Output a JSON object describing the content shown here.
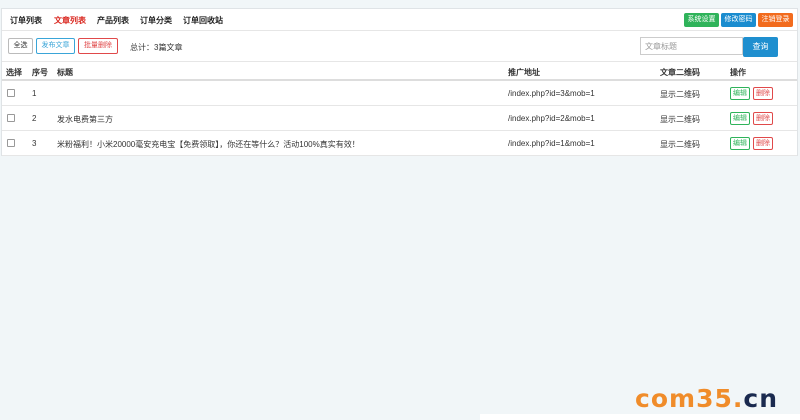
{
  "nav": {
    "items": [
      "订单列表",
      "文章列表",
      "产品列表",
      "订单分类",
      "订单回收站"
    ],
    "active_index": 1,
    "right_buttons": [
      "系统设置",
      "修改密码",
      "注销登录"
    ]
  },
  "toolbar": {
    "select_all": "全选",
    "publish": "发布文章",
    "batch_delete": "批量删除",
    "total": "总计：3篇文章",
    "search_placeholder": "文章标题",
    "search_button": "查询"
  },
  "table": {
    "headers": [
      "选择",
      "序号",
      "标题",
      "推广地址",
      "文章二维码",
      "操作"
    ],
    "rows": [
      {
        "index": "1",
        "title": "",
        "url": "/index.php?id=3&mob=1",
        "qr": "显示二维码"
      },
      {
        "index": "2",
        "title": "发水电费第三方",
        "url": "/index.php?id=2&mob=1",
        "qr": "显示二维码"
      },
      {
        "index": "3",
        "title": "米粉福利！小米20000毫安充电宝【免费领取】，你还在等什么？活动100%真实有效！",
        "url": "/index.php?id=1&mob=1",
        "qr": "显示二维码"
      }
    ],
    "edit_label": "编辑",
    "delete_label": "删除"
  },
  "watermark": {
    "main": "com35",
    "dot": ".",
    "tld": "cn"
  },
  "colors": {
    "active_nav": "#d9241c",
    "green": "#2fb35a",
    "blue": "#1a8ccf",
    "orange": "#f26b1d",
    "primary": "#1f8fcf"
  }
}
